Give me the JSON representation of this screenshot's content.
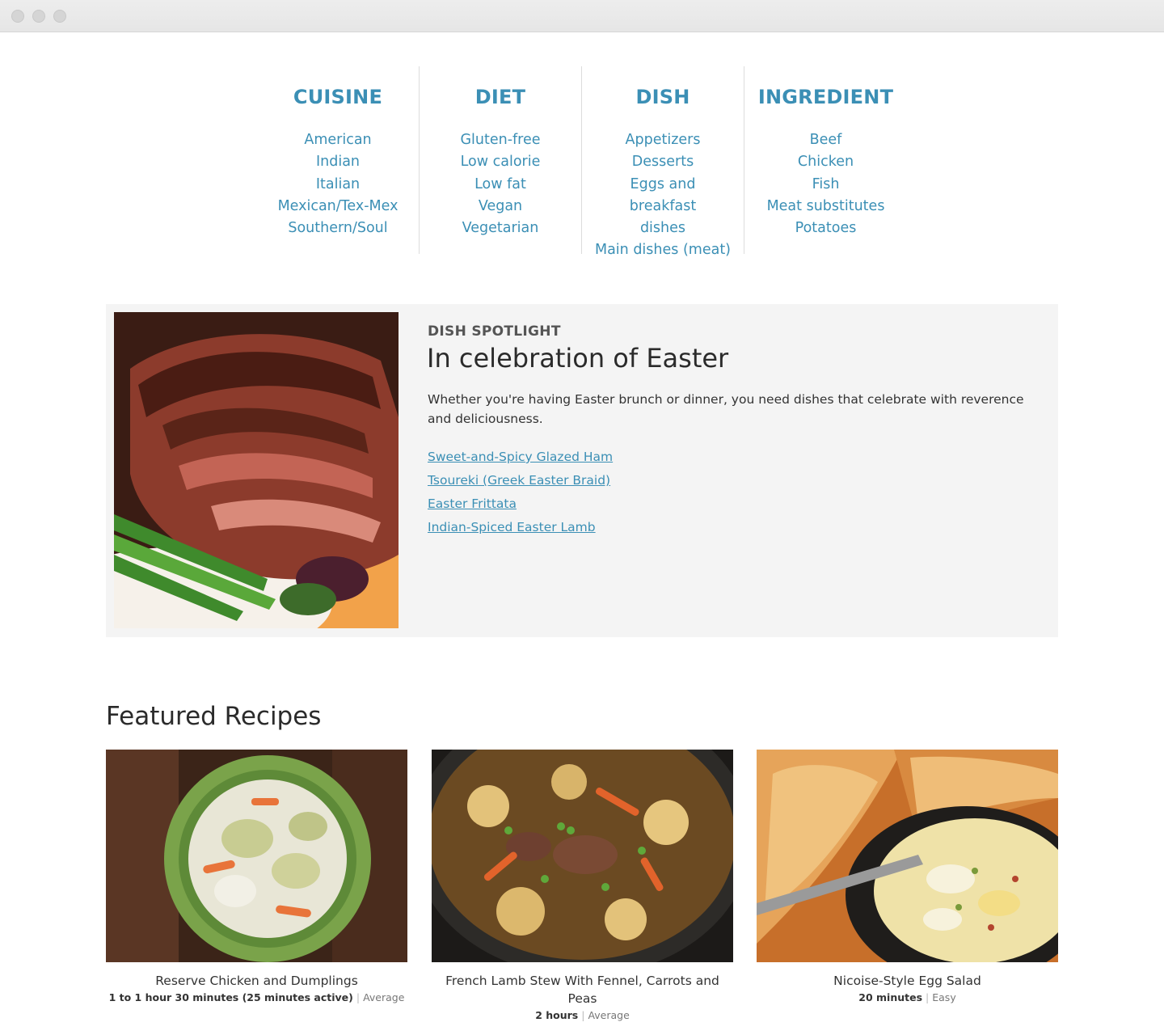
{
  "categories": [
    {
      "title": "CUISINE",
      "items": [
        "American",
        "Indian",
        "Italian",
        "Mexican/Tex-Mex",
        "Southern/Soul"
      ]
    },
    {
      "title": "DIET",
      "items": [
        "Gluten-free",
        "Low calorie",
        "Low fat",
        "Vegan",
        "Vegetarian"
      ]
    },
    {
      "title": "DISH",
      "items": [
        "Appetizers",
        "Desserts",
        "Eggs and breakfast dishes",
        "Main dishes (meat)"
      ]
    },
    {
      "title": "INGREDIENT",
      "items": [
        "Beef",
        "Chicken",
        "Fish",
        "Meat substitutes",
        "Potatoes"
      ]
    }
  ],
  "spotlight": {
    "kicker": "DISH SPOTLIGHT",
    "title": "In celebration of Easter",
    "description": "Whether you're having Easter brunch or dinner, you need dishes that celebrate with reverence and deliciousness.",
    "links": [
      "Sweet-and-Spicy Glazed Ham",
      "Tsoureki (Greek Easter Braid)",
      "Easter Frittata",
      "Indian-Spiced Easter Lamb"
    ]
  },
  "featured": {
    "heading": "Featured Recipes",
    "recipes": [
      {
        "title": "Reserve Chicken and Dumplings",
        "time": "1 to 1 hour 30 minutes (25 minutes active)",
        "difficulty": "Average"
      },
      {
        "title": "French Lamb Stew With Fennel, Carrots and Peas",
        "time": "2 hours",
        "difficulty": "Average"
      },
      {
        "title": "Nicoise-Style Egg Salad",
        "time": "20 minutes",
        "difficulty": "Easy"
      }
    ]
  },
  "colors": {
    "accent": "#3b8fb5",
    "panel": "#f4f4f4"
  }
}
